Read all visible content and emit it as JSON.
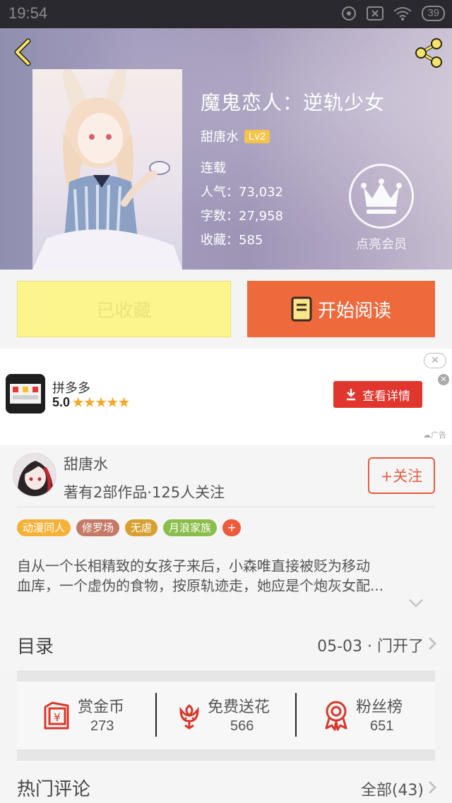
{
  "status_bar": {
    "time": "19:54",
    "battery": "39"
  },
  "book": {
    "title": "魔鬼恋人：逆轨少女",
    "author": "甜唐水",
    "level": "Lv2",
    "status": "连载",
    "popularity": "人气：73,032",
    "word_count": "字数：27,958",
    "favorites": "收藏：585",
    "vip_label": "点亮会员"
  },
  "actions": {
    "collected_label": "已收藏",
    "read_label": "开始阅读"
  },
  "ad": {
    "app_name": "拼多多",
    "rating": "5.0",
    "stars": "★★★★★",
    "button_label": "查看详情",
    "tag": "广告"
  },
  "author_card": {
    "name": "甜唐水",
    "stats": "著有2部作品·125人关注",
    "follow_label": "+关注",
    "tags": [
      {
        "label": "动漫同人",
        "color": "#f6b139"
      },
      {
        "label": "修罗场",
        "color": "#c47a66"
      },
      {
        "label": "无虐",
        "color": "#d8a032"
      },
      {
        "label": "月浪家族",
        "color": "#8bbd4a"
      }
    ],
    "tag_more": "+",
    "description_line1": "自从一个长相精致的女孩子来后，小森唯直接被贬为移动",
    "description_line2": "血库，一个虚伪的食物，按原轨迹走，她应是个炮灰女配..."
  },
  "catalog": {
    "label": "目录",
    "latest": "05-03 · 门开了"
  },
  "gifts": [
    {
      "label": "赏金币",
      "count": "273",
      "icon": "coin-envelope-icon"
    },
    {
      "label": "免费送花",
      "count": "566",
      "icon": "flower-icon"
    },
    {
      "label": "粉丝榜",
      "count": "651",
      "icon": "medal-icon"
    }
  ],
  "hot_comments": {
    "label": "热门评论",
    "all": "全部(43)"
  },
  "colors": {
    "accent": "#ee6a3d",
    "collected_bg": "#fcf48c",
    "ad_button": "#e0362e",
    "gift_icon": "#d9372b"
  }
}
